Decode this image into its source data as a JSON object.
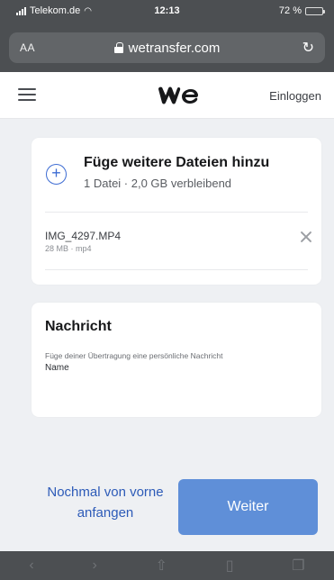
{
  "status": {
    "carrier": "Telekom.de",
    "time": "12:13",
    "battery": "72 %",
    "battery_level": 0.72
  },
  "urlbar": {
    "aa": "AA",
    "domain": "wetransfer.com"
  },
  "header": {
    "login_label": "Einloggen"
  },
  "files_card": {
    "add_title": "Füge weitere Dateien hinzu",
    "add_subtitle": "1 Datei · 2,0 GB verbleibend",
    "file": {
      "name": "IMG_4297.MP4",
      "meta": "28 MB · mp4"
    }
  },
  "message_card": {
    "title": "Nachricht",
    "hint": "Füge deiner Übertragung eine persönliche Nachricht",
    "name_label": "Name"
  },
  "actions": {
    "restart_label": "Nochmal von vorne anfangen",
    "next_label": "Weiter"
  },
  "toolbar": {
    "icons": [
      "back-icon",
      "forward-icon",
      "share-icon",
      "bookmarks-icon",
      "tabs-icon"
    ]
  },
  "colors": {
    "accent": "#3d6cd3",
    "button": "#5f8fd8",
    "chrome": "#4c4f52"
  }
}
